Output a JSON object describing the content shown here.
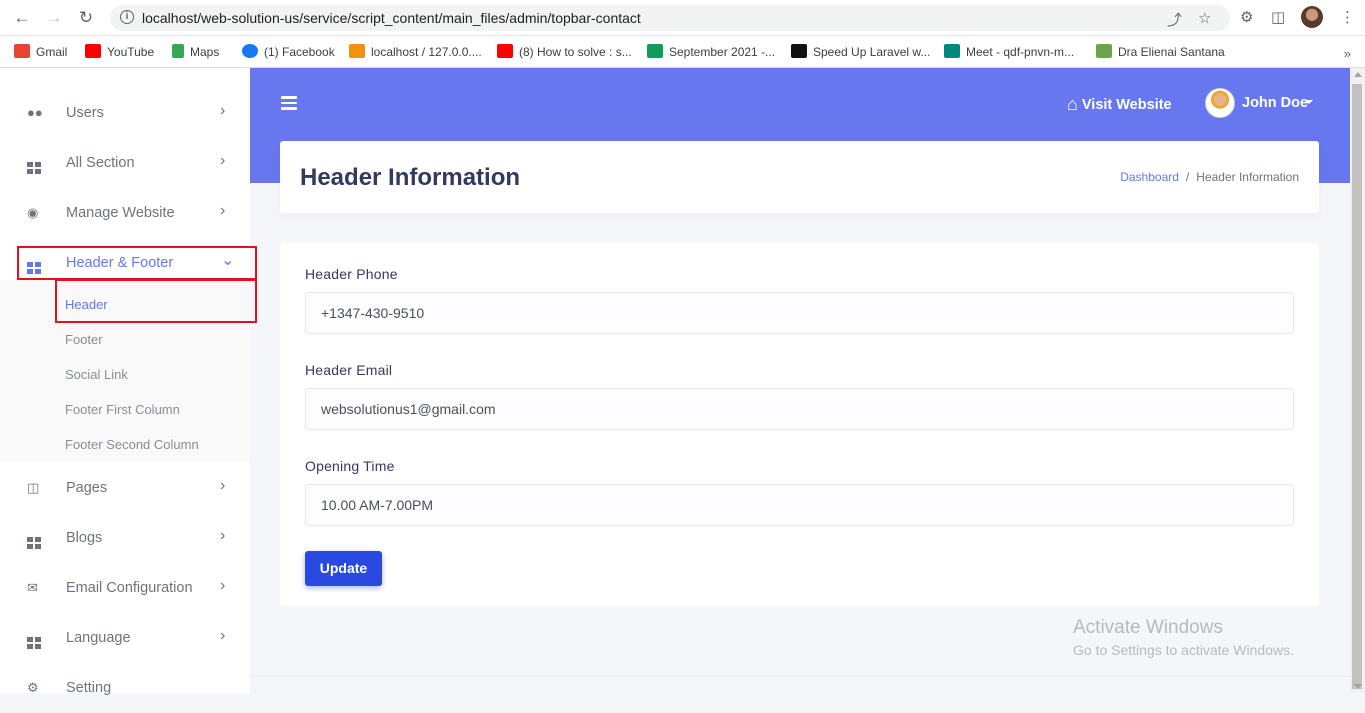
{
  "browser": {
    "url": "localhost/web-solution-us/service/script_content/main_files/admin/topbar-contact",
    "back_icon": "arrow-left-icon",
    "forward_icon": "arrow-right-icon",
    "reload_icon": "reload-icon"
  },
  "bookmarks": [
    {
      "label": "Gmail",
      "color": "#ea4335"
    },
    {
      "label": "YouTube",
      "color": "#ff0000"
    },
    {
      "label": "Maps",
      "color": "#34a853"
    },
    {
      "label": "(1) Facebook",
      "color": "#1877f2"
    },
    {
      "label": "localhost / 127.0.0....",
      "color": "#f29111"
    },
    {
      "label": "(8) How to solve : s...",
      "color": "#ff0000"
    },
    {
      "label": "September 2021 -...",
      "color": "#0f9d58"
    },
    {
      "label": "Speed Up Laravel w...",
      "color": "#111111"
    },
    {
      "label": "Meet - qdf-pnvn-m...",
      "color": "#00897b"
    },
    {
      "label": "Dra Elienai Santana",
      "color": "#6ba44a"
    }
  ],
  "bookmarks_more": "»",
  "sidebar": {
    "items": [
      {
        "label": "Users",
        "icon": "users-icon"
      },
      {
        "label": "All Section",
        "icon": "grid-icon"
      },
      {
        "label": "Manage Website",
        "icon": "globe-icon"
      },
      {
        "label": "Header & Footer",
        "icon": "grid-icon"
      },
      {
        "label": "Pages",
        "icon": "columns-icon"
      },
      {
        "label": "Blogs",
        "icon": "grid-icon"
      },
      {
        "label": "Email Configuration",
        "icon": "envelope-icon"
      },
      {
        "label": "Language",
        "icon": "grid-icon"
      },
      {
        "label": "Setting",
        "icon": "gear-icon"
      }
    ],
    "submenu": [
      "Header",
      "Footer",
      "Social Link",
      "Footer First Column",
      "Footer Second Column"
    ]
  },
  "topbar": {
    "visit_website": "Visit Website",
    "user_name": "John Doe"
  },
  "page": {
    "title": "Header Information",
    "breadcrumb": [
      "Dashboard",
      "/",
      "Header Information"
    ]
  },
  "form": {
    "fields": [
      {
        "label": "Header Phone",
        "value": "+1347-430-9510"
      },
      {
        "label": "Header Email",
        "value": "websolutionus1@gmail.com"
      },
      {
        "label": "Opening Time",
        "value": "10.00 AM-7.00PM"
      }
    ],
    "submit_label": "Update"
  },
  "watermark": {
    "line1": "Activate Windows",
    "line2": "Go to Settings to activate Windows."
  },
  "colors": {
    "accent": "#6777ef",
    "button": "#2a49e0",
    "highlight_box": "#e0141c"
  }
}
